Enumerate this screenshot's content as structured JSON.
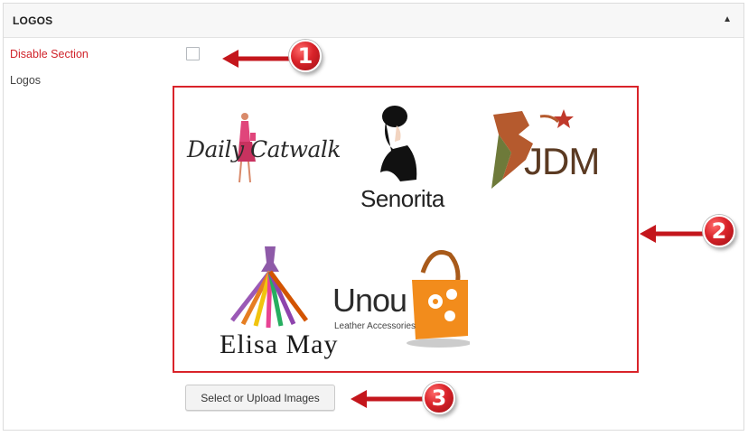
{
  "section": {
    "title": "LOGOS",
    "toggle_icon": "triangle-up-icon"
  },
  "fields": {
    "disable_label": "Disable Section",
    "disable_checked": false,
    "logos_label": "Logos"
  },
  "gallery": {
    "logos": [
      {
        "name": "Daily Catwalk"
      },
      {
        "name": "Senorita"
      },
      {
        "name": "JDM"
      },
      {
        "name": "Elisa May"
      },
      {
        "name": "Unou",
        "tagline": "Leather Accessories"
      }
    ]
  },
  "upload_button_label": "Select or Upload Images",
  "callouts": [
    {
      "number": "1"
    },
    {
      "number": "2"
    },
    {
      "number": "3"
    }
  ],
  "colors": {
    "accent_red": "#d9232a",
    "label_red": "#d0232a"
  }
}
